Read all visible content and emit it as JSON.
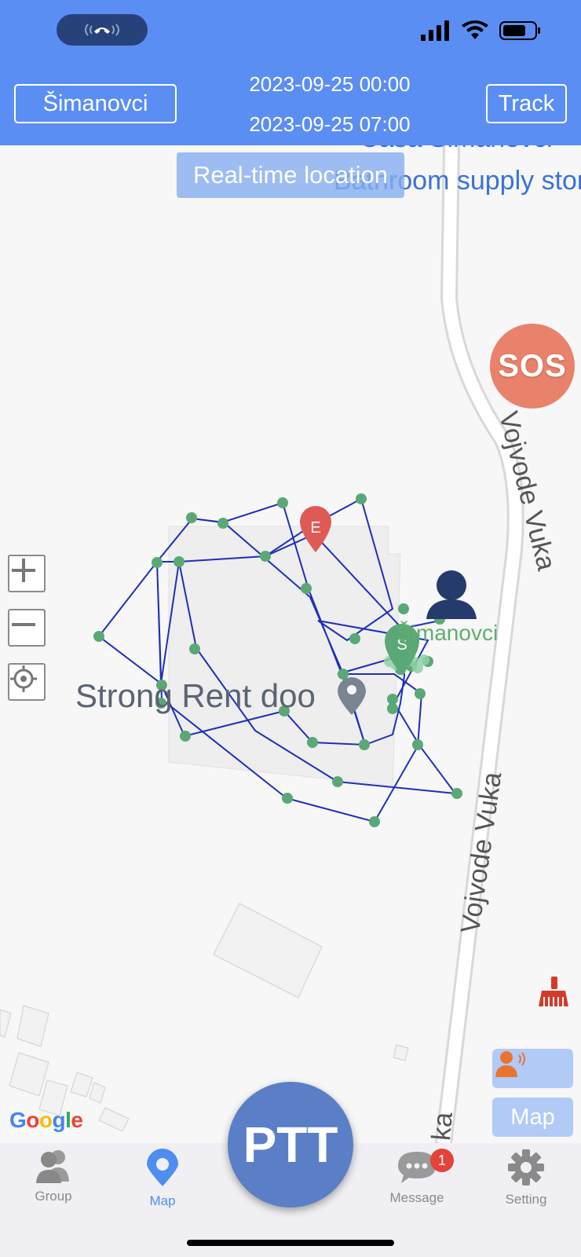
{
  "header": {
    "device_selector": "Šimanovci",
    "date_start": "2023-09-25 00:00",
    "date_end": "2023-09-25 07:00",
    "track_button": "Track",
    "background": "#5b8ef2"
  },
  "status_bar": {
    "call_pill_icon": "phone-icon",
    "icons": [
      "signal-icon",
      "wifi-icon",
      "battery-icon"
    ]
  },
  "map": {
    "place_label_top": "Casa Šimanovci",
    "place_label_sub": "Bathroom supply store",
    "realtime_button": "Real-time location",
    "sos_button": "SOS",
    "poi_label": "Strong Rent doo",
    "member_label": "Šimanovci",
    "road_name": "Vojvode Vuka",
    "road_name_partial": "ka",
    "start_marker": "S",
    "end_marker": "E",
    "google_logo": "Google",
    "track_line_color": "#1f2fb8",
    "track_point_color": "#5aa876",
    "end_marker_color": "#e05a55",
    "start_marker_color": "#5aa876",
    "zoom_controls": [
      "zoom-in-icon",
      "zoom-out-icon",
      "locate-icon"
    ]
  },
  "side_buttons": {
    "intercom_icon": "person-voice-icon",
    "map_label": "Map",
    "broom_icon": "broom-icon"
  },
  "tabbar": {
    "tabs": [
      {
        "label": "Group",
        "icon": "group-icon"
      },
      {
        "label": "Map",
        "icon": "map-pin-icon"
      },
      {
        "label": "Message",
        "icon": "message-icon"
      },
      {
        "label": "Setting",
        "icon": "gear-icon"
      }
    ],
    "active_tab": "Map",
    "ptt_label": "PTT",
    "message_badge": "1"
  }
}
